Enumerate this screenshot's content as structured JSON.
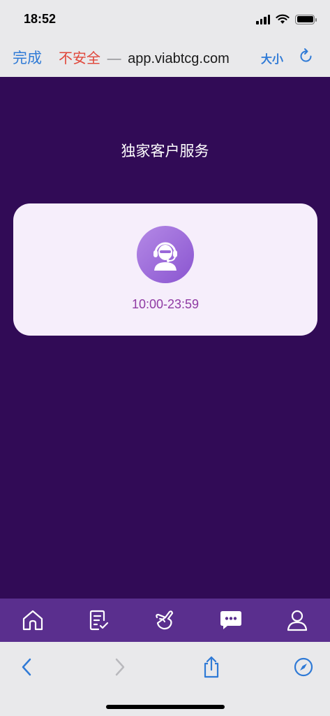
{
  "status_bar": {
    "time": "18:52"
  },
  "browser": {
    "done_label": "完成",
    "insecure_label": "不安全",
    "separator": "—",
    "url": "app.viabtcg.com",
    "text_size_label": "大小"
  },
  "page": {
    "title": "独家客户服务",
    "service_card": {
      "hours": "10:00-23:59"
    }
  },
  "tab_bar": {
    "tabs": [
      {
        "icon": "home-icon"
      },
      {
        "icon": "orders-icon"
      },
      {
        "icon": "hand-icon"
      },
      {
        "icon": "chat-icon"
      },
      {
        "icon": "profile-icon"
      }
    ]
  },
  "colors": {
    "background": "#310b56",
    "card": "#f6eefb",
    "tab_bar": "#5a2f8e",
    "hours_text": "#8f3aa3",
    "browser_accent": "#2f7ad6",
    "insecure": "#e0463a"
  }
}
